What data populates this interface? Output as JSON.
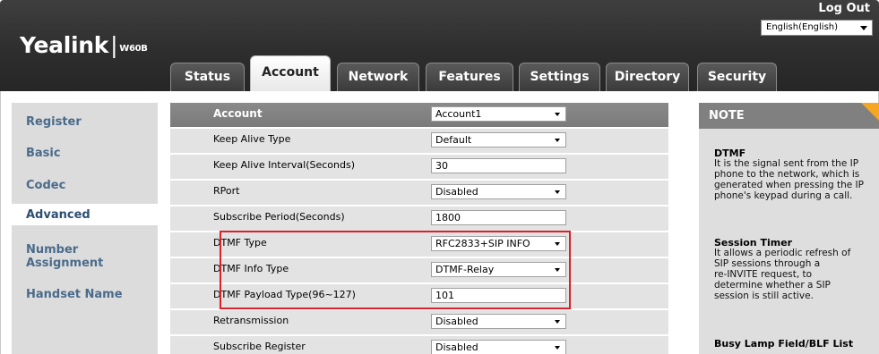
{
  "header": {
    "logo_brand": "Yealink",
    "logo_sep": "|",
    "logo_model": "W60B",
    "logout": "Log Out",
    "language": "English(English)"
  },
  "tabs": [
    {
      "label": "Status",
      "active": false
    },
    {
      "label": "Account",
      "active": true
    },
    {
      "label": "Network",
      "active": false
    },
    {
      "label": "Features",
      "active": false
    },
    {
      "label": "Settings",
      "active": false
    },
    {
      "label": "Directory",
      "active": false
    },
    {
      "label": "Security",
      "active": false
    }
  ],
  "sidebar": {
    "items": [
      {
        "label": "Register"
      },
      {
        "label": "Basic"
      },
      {
        "label": "Codec"
      },
      {
        "label": "Advanced",
        "active": true
      },
      {
        "label": "Number"
      },
      {
        "label": "Assignment"
      },
      {
        "label": "Handset Name"
      }
    ]
  },
  "settings": {
    "rows": [
      {
        "label": "Account",
        "value": "Account1",
        "control": "select"
      },
      {
        "label": "Keep Alive Type",
        "value": "Default",
        "control": "select"
      },
      {
        "label": "Keep Alive Interval(Seconds)",
        "value": "30",
        "control": "text"
      },
      {
        "label": "RPort",
        "value": "Disabled",
        "control": "select"
      },
      {
        "label": "Subscribe Period(Seconds)",
        "value": "1800",
        "control": "text"
      },
      {
        "label": "DTMF Type",
        "value": "RFC2833+SIP INFO",
        "control": "select"
      },
      {
        "label": "DTMF Info Type",
        "value": "DTMF-Relay",
        "control": "select"
      },
      {
        "label": "DTMF Payload Type(96~127)",
        "value": "101",
        "control": "text"
      },
      {
        "label": "Retransmission",
        "value": "Disabled",
        "control": "select"
      },
      {
        "label": "Subscribe Register",
        "value": "Disabled",
        "control": "select"
      }
    ]
  },
  "note": {
    "heading": "NOTE",
    "sections": [
      {
        "title": "DTMF",
        "lines": [
          "It is the signal sent from the IP",
          "phone to the network, which is",
          "generated when pressing the IP",
          "phone's keypad during a call."
        ]
      },
      {
        "title": "Session Timer",
        "lines": [
          "It allows a periodic refresh of",
          "SIP sessions through a",
          "re-INVITE request, to",
          "determine whether a SIP",
          "session is still active."
        ]
      },
      {
        "title": "Busy Lamp Field/BLF List",
        "lines": []
      }
    ]
  },
  "colors": {
    "highlight": "#d9222a",
    "note_corner": "#f5a623",
    "sidebar_link": "#4a6b8c"
  }
}
